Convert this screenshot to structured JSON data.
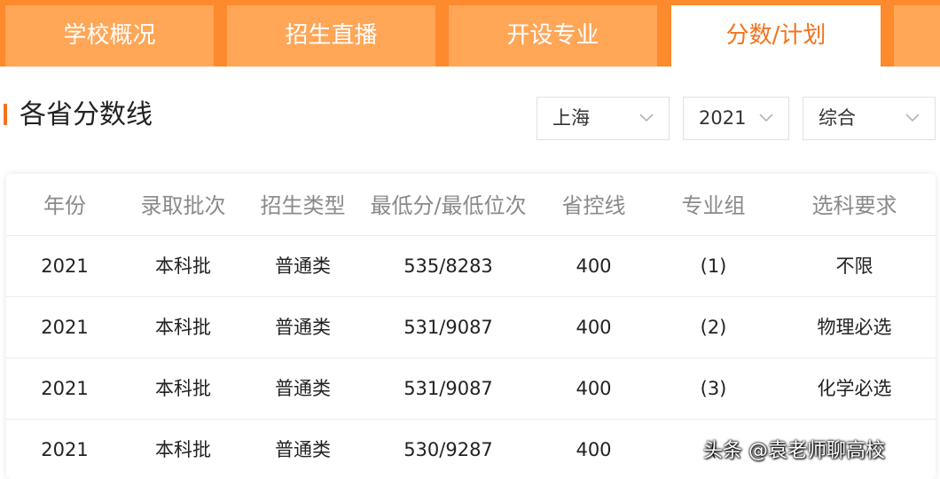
{
  "tabs": [
    {
      "label": "学校概况"
    },
    {
      "label": "招生直播"
    },
    {
      "label": "开设专业"
    },
    {
      "label": "分数/计划"
    }
  ],
  "section": {
    "title": "各省分数线"
  },
  "filters": {
    "province": "上海",
    "year": "2021",
    "category": "综合"
  },
  "table": {
    "headers": [
      "年份",
      "录取批次",
      "招生类型",
      "最低分/最低位次",
      "省控线",
      "专业组",
      "选科要求"
    ],
    "rows": [
      [
        "2021",
        "本科批",
        "普通类",
        "535/8283",
        "400",
        "(1)",
        "不限"
      ],
      [
        "2021",
        "本科批",
        "普通类",
        "531/9087",
        "400",
        "(2)",
        "物理必选"
      ],
      [
        "2021",
        "本科批",
        "普通类",
        "531/9087",
        "400",
        "(3)",
        "化学必选"
      ],
      [
        "2021",
        "本科批",
        "普通类",
        "530/9287",
        "400",
        "(",
        ""
      ]
    ]
  },
  "watermark": "头条 @袁老师聊高校",
  "colors": {
    "accent": "#f5731c",
    "tab_bg": "#ffa657",
    "tabbar_bg": "#fd8a2c"
  }
}
